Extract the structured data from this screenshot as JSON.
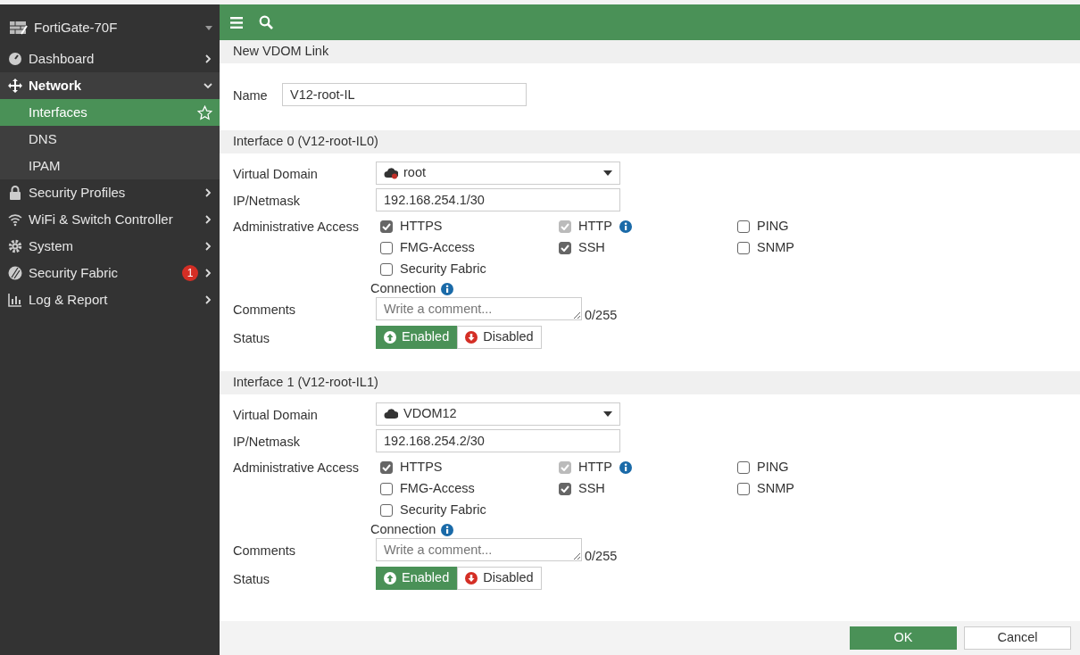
{
  "sidebar": {
    "device": "FortiGate-70F",
    "items": [
      {
        "kind": "dashboard",
        "label": "Dashboard",
        "expanded": false
      },
      {
        "kind": "network",
        "label": "Network",
        "expanded": true,
        "children": [
          {
            "label": "Interfaces",
            "selected": true
          },
          {
            "label": "DNS",
            "selected": false
          },
          {
            "label": "IPAM",
            "selected": false
          }
        ]
      },
      {
        "kind": "lock",
        "label": "Security Profiles",
        "expanded": false
      },
      {
        "kind": "wifi",
        "label": "WiFi & Switch Controller",
        "expanded": false
      },
      {
        "kind": "gear",
        "label": "System",
        "expanded": false
      },
      {
        "kind": "fabric",
        "label": "Security Fabric",
        "expanded": false,
        "badge": "1"
      },
      {
        "kind": "chart",
        "label": "Log & Report",
        "expanded": false
      }
    ]
  },
  "form": {
    "title": "New VDOM Link",
    "name": {
      "label": "Name",
      "value": "V12-root-IL"
    },
    "interfaces": [
      {
        "title": "Interface 0 (V12-root-IL0)",
        "vdom_label": "Virtual Domain",
        "vdom": "root",
        "vdom_alert": true,
        "ip_label": "IP/Netmask",
        "ip": "192.168.254.1/30",
        "access_label": "Administrative Access",
        "access": [
          {
            "label": "HTTPS",
            "checked": true,
            "disabled": false
          },
          {
            "label": "HTTP",
            "checked": true,
            "disabled": true,
            "info": true
          },
          {
            "label": "PING",
            "checked": false,
            "disabled": false
          },
          {
            "label": "FMG-Access",
            "checked": false,
            "disabled": false
          },
          {
            "label": "SSH",
            "checked": true,
            "disabled": false
          },
          {
            "label": "SNMP",
            "checked": false,
            "disabled": false
          },
          {
            "label": "Security Fabric",
            "label_line2": "Connection",
            "checked": false,
            "disabled": false,
            "info": true
          }
        ],
        "comments_label": "Comments",
        "comments_placeholder": "Write a comment...",
        "comments_count": "0/255",
        "status_label": "Status",
        "status": [
          {
            "kind": "up",
            "label": "Enabled",
            "selected": true
          },
          {
            "kind": "down",
            "label": "Disabled",
            "selected": false
          }
        ]
      },
      {
        "title": "Interface 1 (V12-root-IL1)",
        "vdom_label": "Virtual Domain",
        "vdom": "VDOM12",
        "vdom_alert": false,
        "ip_label": "IP/Netmask",
        "ip": "192.168.254.2/30",
        "access_label": "Administrative Access",
        "access": [
          {
            "label": "HTTPS",
            "checked": true,
            "disabled": false
          },
          {
            "label": "HTTP",
            "checked": true,
            "disabled": true,
            "info": true
          },
          {
            "label": "PING",
            "checked": false,
            "disabled": false
          },
          {
            "label": "FMG-Access",
            "checked": false,
            "disabled": false
          },
          {
            "label": "SSH",
            "checked": true,
            "disabled": false
          },
          {
            "label": "SNMP",
            "checked": false,
            "disabled": false
          },
          {
            "label": "Security Fabric",
            "label_line2": "Connection",
            "checked": false,
            "disabled": false,
            "info": true
          }
        ],
        "comments_label": "Comments",
        "comments_placeholder": "Write a comment...",
        "comments_count": "0/255",
        "status_label": "Status",
        "status": [
          {
            "kind": "up",
            "label": "Enabled",
            "selected": true
          },
          {
            "kind": "down",
            "label": "Disabled",
            "selected": false
          }
        ]
      }
    ]
  },
  "buttons": [
    {
      "kind": "primary",
      "label": "OK"
    },
    {
      "kind": "secondary",
      "label": "Cancel"
    }
  ]
}
